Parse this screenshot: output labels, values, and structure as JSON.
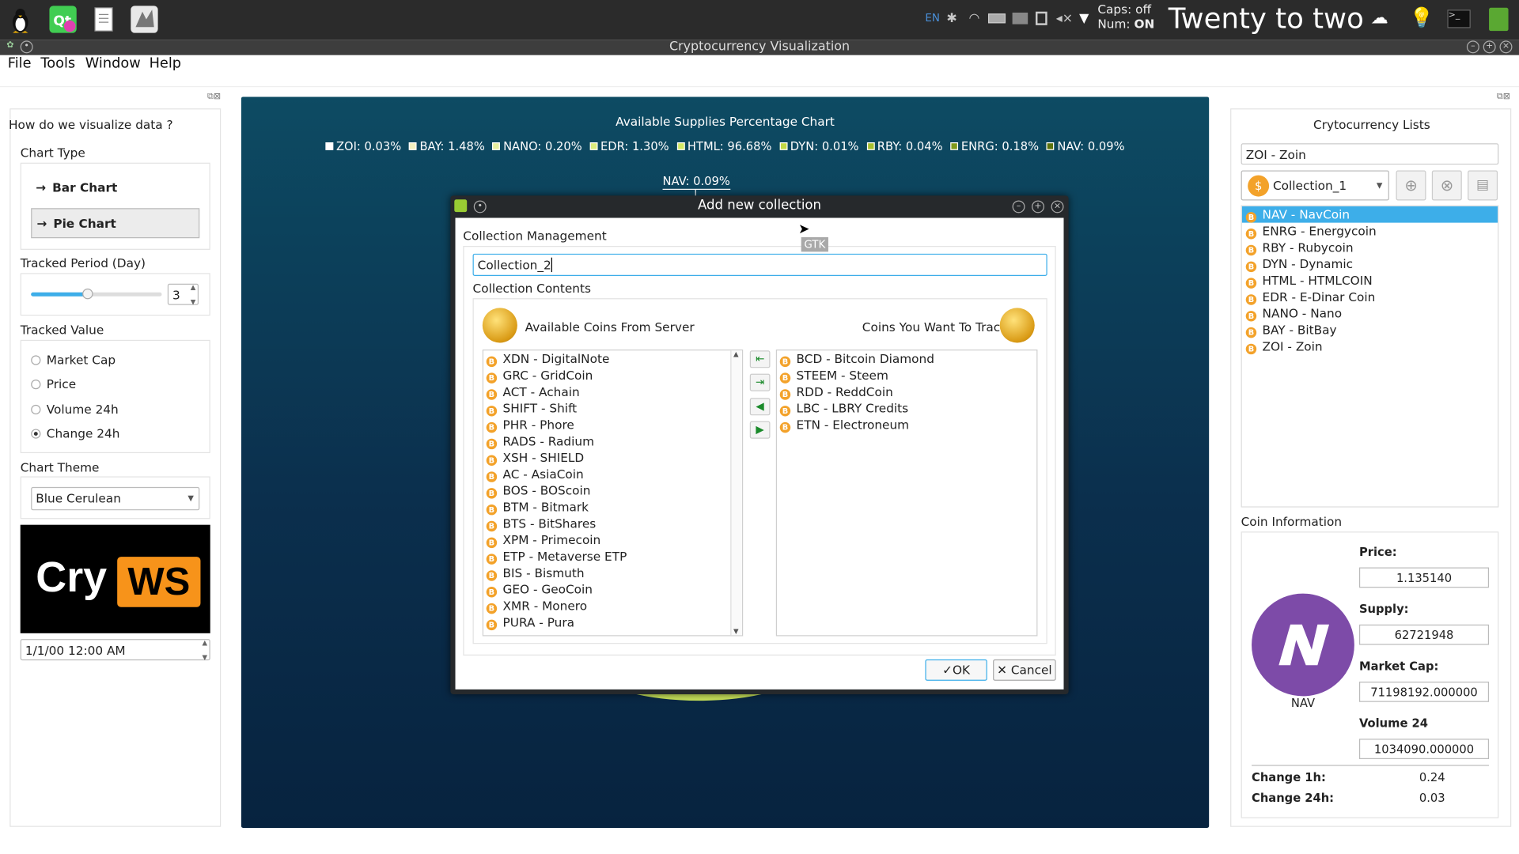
{
  "topbar": {
    "lang": "EN",
    "caps": "Caps: off",
    "num_label": "Num:",
    "num_value": "ON",
    "clock": "Twenty to two"
  },
  "window": {
    "title": "Cryptocurrency Visualization"
  },
  "menu": [
    "File",
    "Tools",
    "Window",
    "Help"
  ],
  "left": {
    "heading": "How do we visualize data ?",
    "chart_type_label": "Chart Type",
    "chart_buttons": [
      "Bar Chart",
      "Pie Chart"
    ],
    "period_label": "Tracked Period (Day)",
    "period_value": "3",
    "period_slider_fraction": 0.43,
    "tracked_value_label": "Tracked Value",
    "tracked_options": [
      "Market Cap",
      "Price",
      "Volume 24h",
      "Change 24h"
    ],
    "tracked_selected": "Change 24h",
    "theme_label": "Chart Theme",
    "theme_value": "Blue Cerulean",
    "logo_text_1": "Cry",
    "logo_text_2": "WS",
    "datetime": "1/1/00 12:00 AM"
  },
  "chart": {
    "title": "Available Supplies Percentage Chart",
    "legend": [
      {
        "label": "ZOI: 0.03%",
        "color": "#ffffff"
      },
      {
        "label": "BAY: 1.48%",
        "color": "#f2f1c0"
      },
      {
        "label": "NANO: 0.20%",
        "color": "#e6ef9e"
      },
      {
        "label": "EDR: 1.30%",
        "color": "#dcec7c"
      },
      {
        "label": "HTML: 96.68%",
        "color": "#d4ea63"
      },
      {
        "label": "DYN: 0.01%",
        "color": "#c3d944"
      },
      {
        "label": "RBY: 0.04%",
        "color": "#a7bf2c"
      },
      {
        "label": "ENRG: 0.18%",
        "color": "#7f9a1a"
      },
      {
        "label": "NAV: 0.09%",
        "color": "#5c730c"
      }
    ],
    "slice_label": "NAV: 0.09%"
  },
  "right": {
    "heading": "Crytocurrency Lists",
    "search_value": "ZOI - Zoin",
    "collection": "Collection_1",
    "coins": [
      "NAV - NavCoin",
      "ENRG - Energycoin",
      "RBY - Rubycoin",
      "DYN - Dynamic",
      "HTML - HTMLCOIN",
      "EDR - E-Dinar Coin",
      "NANO - Nano",
      "BAY - BitBay",
      "ZOI - Zoin"
    ],
    "selected_coin": "NAV - NavCoin",
    "info_heading": "Coin Information",
    "coin_symbol": "NAV",
    "price_label": "Price:",
    "price": "1.135140",
    "supply_label": "Supply:",
    "supply": "62721948",
    "mcap_label": "Market Cap:",
    "mcap": "71198192.000000",
    "volume_label": "Volume 24",
    "volume": "1034090.000000",
    "change1h_label": "Change 1h:",
    "change1h": "0.24",
    "change24h_label": "Change 24h:",
    "change24h": "0.03"
  },
  "tooltip": "GTK",
  "dialog": {
    "title": "Add new collection",
    "mgmt_label": "Collection Management",
    "name_value": "Collection_2",
    "contents_label": "Collection Contents",
    "available_label": "Available Coins From Server",
    "track_label": "Coins You Want To Track",
    "available": [
      "XDN - DigitalNote",
      "GRC - GridCoin",
      "ACT - Achain",
      "SHIFT - Shift",
      "PHR - Phore",
      "RADS - Radium",
      "XSH - SHIELD",
      "AC - AsiaCoin",
      "BOS - BOScoin",
      "BTM - Bitmark",
      "BTS - BitShares",
      "XPM - Primecoin",
      "ETP - Metaverse ETP",
      "BIS - Bismuth",
      "GEO - GeoCoin",
      "XMR - Monero",
      "PURA - Pura"
    ],
    "tracked": [
      "BCD - Bitcoin Diamond",
      "STEEM - Steem",
      "RDD - ReddCoin",
      "LBC - LBRY Credits",
      "ETN - Electroneum"
    ],
    "ok": "OK",
    "cancel": "Cancel"
  }
}
